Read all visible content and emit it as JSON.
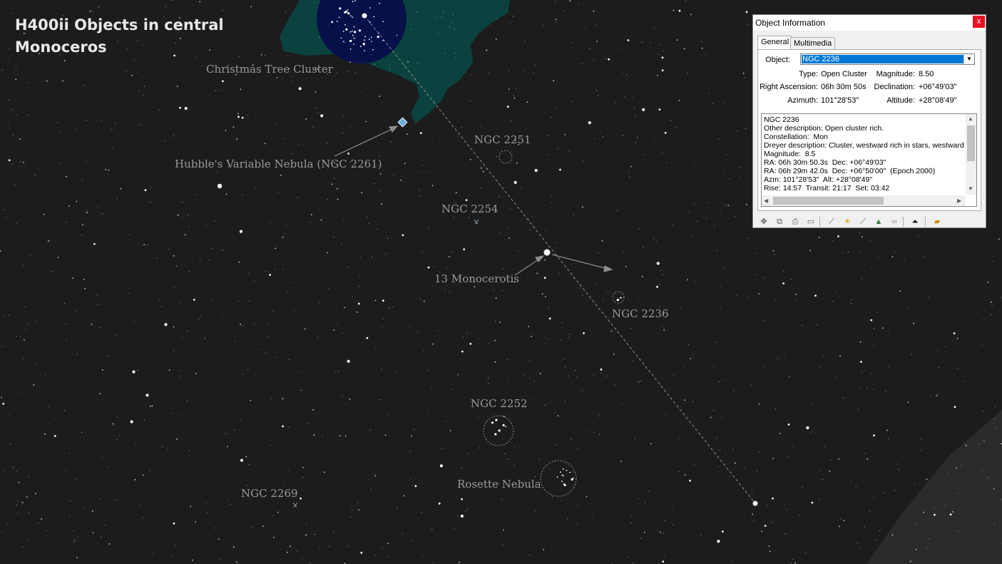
{
  "overlay": {
    "title": "H400ii Objects in central Monoceros"
  },
  "labels": {
    "christmas_tree": "Christmas Tree Cluster",
    "hubble": "Hubble's Variable Nebula (NGC 2261)",
    "ngc2251": "NGC 2251",
    "ngc2254": "NGC 2254",
    "mon13": "13 Monocerotis",
    "ngc2236": "NGC 2236",
    "ngc2252": "NGC 2252",
    "rosette": "Rosette Nebula",
    "ngc2269": "NGC 2269"
  },
  "dialog": {
    "title": "Object Information",
    "close": "x",
    "tabs": [
      "General",
      "Multimedia"
    ],
    "object_label": "Object:",
    "object_value": "NGC 2236",
    "type_label": "Type:",
    "type_value": "Open Cluster",
    "magnitude_label": "Magnitude:",
    "magnitude_value": "8.50",
    "ra_label": "Right Ascension:",
    "ra_value": "06h 30m 50s",
    "dec_label": "Declination:",
    "dec_value": "+06°49'03\"",
    "azimuth_label": "Azimuth:",
    "azimuth_value": "101°28'53\"",
    "altitude_label": "Altitude:",
    "altitude_value": "+28°08'49\"",
    "description": "NGC 2236\nOther description: Open cluster rich.\nConstellation:  Mon\nDreyer description: Cluster, westward rich in stars, westward comp\nMagnitude:  8.5\nRA: 06h 30m 50.3s  Dec: +06°49'03\"\nRA: 06h 29m 42.0s  Dec: +06°50'00\"  (Epoch 2000)\nAzm: 101°28'53\"  Alt: +28°08'49\"\nRise: 14:57  Transit: 21:17  Set: 03:42"
  },
  "toolbar_icons": [
    "center-icon",
    "copy-icon",
    "print-icon",
    "book-icon",
    "ruler-icon",
    "sun-icon",
    "telescope-icon",
    "chart-icon",
    "link-icon",
    "up-arrow-icon",
    "open-folder-icon"
  ],
  "colors": {
    "sky": "#1c1c1c",
    "nebula": "#0b4240",
    "cluster_disc": "#08104a",
    "hubble_marker": "#6aaee0"
  }
}
